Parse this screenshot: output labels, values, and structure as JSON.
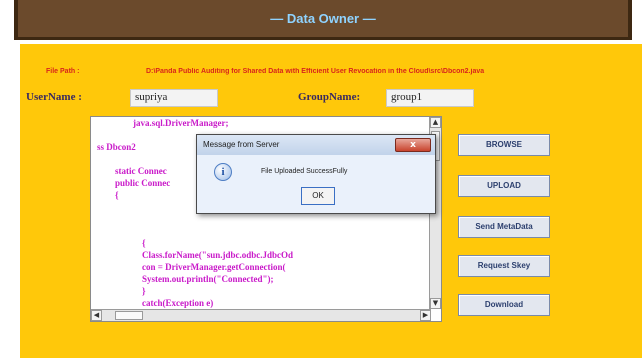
{
  "window": {
    "title": "— Data Owner —"
  },
  "form": {
    "filepath_label": "File Path :",
    "filepath_value": "D:\\Panda Public Auditing for Shared Data with Efficient User Revocation in the Cloud\\src\\Dbcon2.java",
    "username_label": "UserName :",
    "username_value": "supriya",
    "groupname_label": "GroupName:",
    "groupname_value": "group1"
  },
  "editor": {
    "lines": [
      "                java.sql.DriverManager;",
      "",
      "ss Dbcon2",
      "",
      "        static Connec",
      "        public Connec",
      "        {",
      "",
      "",
      "",
      "                    {",
      "                    Class.forName(\"sun.jdbc.odbc.JdbcOd",
      "                    con = DriverManager.getConnection(",
      "                    System.out.println(\"Connected\");",
      "                    }",
      "                    catch(Exception e)",
      "                    {"
    ]
  },
  "buttons": {
    "browse": "BROWSE",
    "upload": "UPLOAD",
    "send_metadata": "Send MetaData",
    "request_skey": "Request Skey",
    "download": "Download"
  },
  "dialog": {
    "title": "Message from Server",
    "close": "x",
    "message": "File Uploaded SuccessFully",
    "ok": "OK",
    "icon": "info-icon"
  },
  "colors": {
    "panel": "#ffc80a",
    "titlebar": "#6b4a2c",
    "title_text": "#8fd3ff",
    "filepath_text": "#d8261c",
    "code_text": "#c91ac9",
    "label_text": "#3a2a60"
  }
}
